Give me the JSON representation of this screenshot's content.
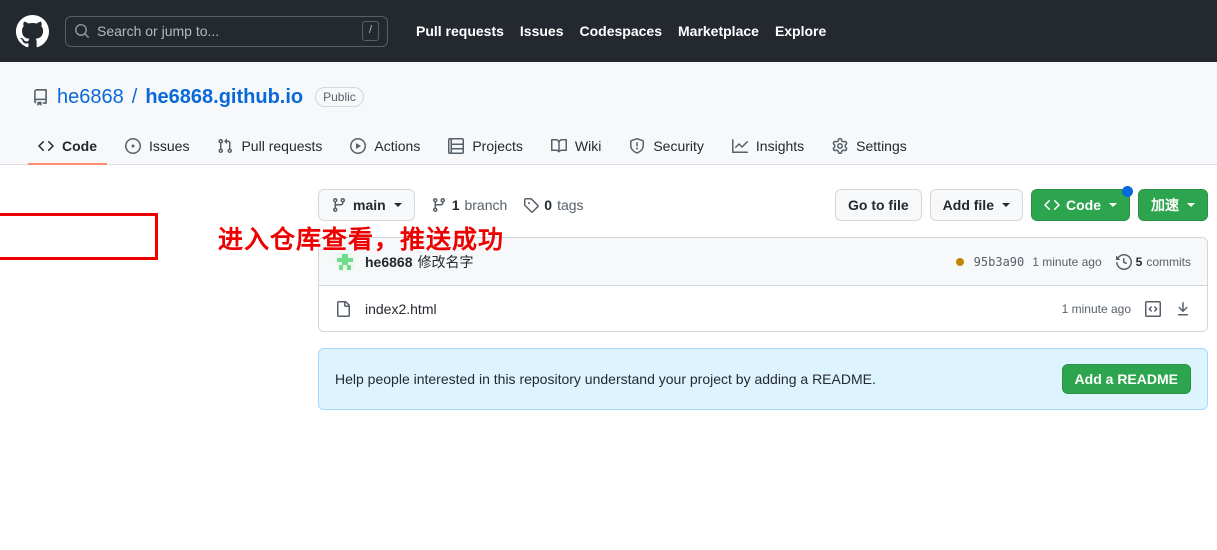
{
  "header": {
    "logo_icon": "github-mark-icon",
    "search": {
      "icon": "search-icon",
      "placeholder": "Search or jump to...",
      "value": "",
      "shortcut_key": "/"
    },
    "nav_links": [
      {
        "label": "Pull requests"
      },
      {
        "label": "Issues"
      },
      {
        "label": "Codespaces"
      },
      {
        "label": "Marketplace"
      },
      {
        "label": "Explore"
      }
    ],
    "background_color": "#24292f"
  },
  "repo": {
    "icon": "repo-icon",
    "owner": "he6868",
    "separator": "/",
    "name": "he6868.github.io",
    "visibility": "Public",
    "link_color": "#0969da"
  },
  "tabs": [
    {
      "label": "Code",
      "icon": "code-icon",
      "active": true
    },
    {
      "label": "Issues",
      "icon": "issue-opened-icon",
      "active": false
    },
    {
      "label": "Pull requests",
      "icon": "git-pull-request-icon",
      "active": false
    },
    {
      "label": "Actions",
      "icon": "play-icon",
      "active": false
    },
    {
      "label": "Projects",
      "icon": "table-icon",
      "active": false
    },
    {
      "label": "Wiki",
      "icon": "book-icon",
      "active": false
    },
    {
      "label": "Security",
      "icon": "shield-icon",
      "active": false
    },
    {
      "label": "Insights",
      "icon": "graph-icon",
      "active": false
    },
    {
      "label": "Settings",
      "icon": "gear-icon",
      "active": false
    }
  ],
  "toolbar": {
    "branch": {
      "icon": "git-branch-icon",
      "name": "main"
    },
    "branch_count": {
      "icon": "git-branch-icon",
      "count": "1",
      "label": "branch"
    },
    "tag_count": {
      "icon": "tag-icon",
      "count": "0",
      "label": "tags"
    },
    "go_to_file_label": "Go to file",
    "add_file_label": "Add file",
    "code_label": "Code",
    "code_icon": "code-icon",
    "accelerate_label": "加速",
    "code_button_color": "#2da44e",
    "notification_dot_color": "#0969da"
  },
  "commit": {
    "avatar": "user-avatar-identicon",
    "author": "he6868",
    "message": "修改名字",
    "status_dot_color": "#bf8700",
    "sha": "95b3a90",
    "time": "1 minute ago",
    "commits_icon": "history-icon",
    "commits_count": "5",
    "commits_label": "commits"
  },
  "files": [
    {
      "icon": "file-icon",
      "name": "index2.html",
      "time": "1 minute ago",
      "code_icon": "code-square-icon",
      "download_icon": "download-icon"
    }
  ],
  "readme_banner": {
    "text": "Help people interested in this repository understand your project by adding a README.",
    "button_label": "Add a README",
    "background_color": "#ddf4ff",
    "button_color": "#2da44e"
  },
  "annotation": {
    "text": "进入仓库查看，推送成功",
    "color": "#ee0000"
  }
}
